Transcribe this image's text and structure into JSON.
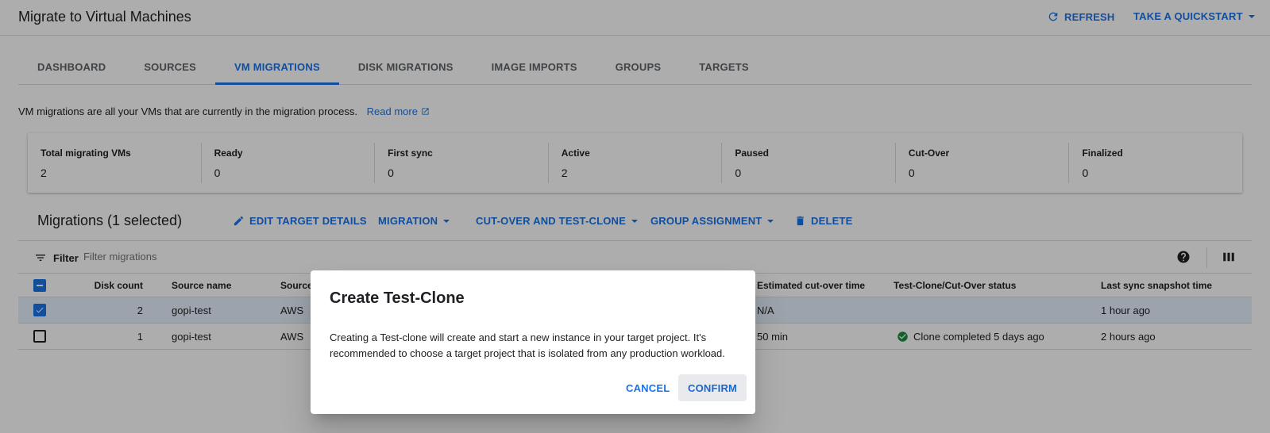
{
  "header": {
    "title": "Migrate to Virtual Machines",
    "refresh_label": "REFRESH",
    "quickstart_label": "TAKE A QUICKSTART"
  },
  "tabs": [
    {
      "label": "DASHBOARD",
      "active": false
    },
    {
      "label": "SOURCES",
      "active": false
    },
    {
      "label": "VM MIGRATIONS",
      "active": true
    },
    {
      "label": "DISK MIGRATIONS",
      "active": false
    },
    {
      "label": "IMAGE IMPORTS",
      "active": false
    },
    {
      "label": "GROUPS",
      "active": false
    },
    {
      "label": "TARGETS",
      "active": false
    }
  ],
  "description": {
    "text": "VM migrations are all your VMs that are currently in the migration process.",
    "link": "Read more"
  },
  "stats": [
    {
      "label": "Total migrating VMs",
      "value": "2"
    },
    {
      "label": "Ready",
      "value": "0"
    },
    {
      "label": "First sync",
      "value": "0"
    },
    {
      "label": "Active",
      "value": "2"
    },
    {
      "label": "Paused",
      "value": "0"
    },
    {
      "label": "Cut-Over",
      "value": "0"
    },
    {
      "label": "Finalized",
      "value": "0"
    }
  ],
  "toolbar": {
    "title": "Migrations (1 selected)",
    "edit_target": "EDIT TARGET DETAILS",
    "migration": "MIGRATION",
    "cutover": "CUT-OVER AND TEST-CLONE",
    "group_assignment": "GROUP ASSIGNMENT",
    "delete": "DELETE"
  },
  "filter": {
    "label": "Filter",
    "placeholder": "Filter migrations"
  },
  "table": {
    "headers": {
      "disk_count": "Disk count",
      "source_name": "Source name",
      "source": "Source",
      "est_cutover": "Estimated cut-over time",
      "status": "Test-Clone/Cut-Over status",
      "last_sync": "Last sync snapshot time"
    },
    "rows": [
      {
        "selected": true,
        "disk_count": "2",
        "source_name": "gopi-test",
        "source": "AWS",
        "est_cutover": "N/A",
        "status": "",
        "last_sync": "1 hour ago"
      },
      {
        "selected": false,
        "disk_count": "1",
        "source_name": "gopi-test",
        "source": "AWS",
        "est_cutover": "50 min",
        "status": "Clone completed 5 days ago",
        "last_sync": "2 hours ago"
      }
    ]
  },
  "dialog": {
    "title": "Create Test-Clone",
    "body": "Creating a Test-clone will create and start a new instance in your target project. It's recommended to choose a target project that is isolated from any production workload.",
    "cancel": "CANCEL",
    "confirm": "CONFIRM"
  },
  "colors": {
    "accent": "#1a73e8",
    "success": "#1e8e3e",
    "selected_row": "#e8f0fe"
  }
}
